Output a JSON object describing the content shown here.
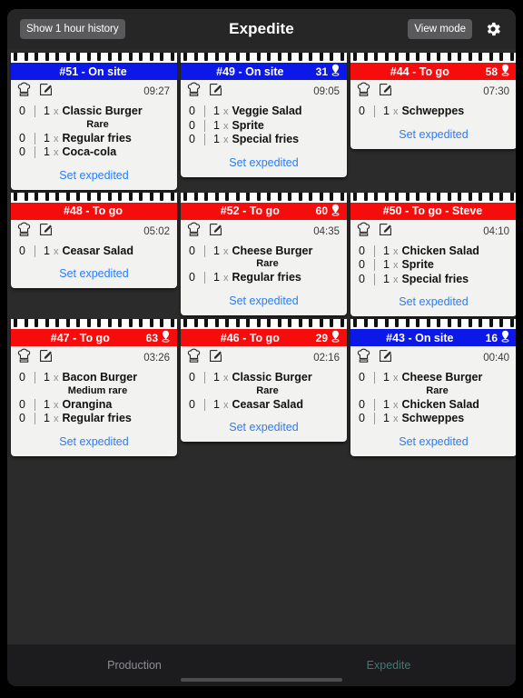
{
  "header": {
    "history_button": "Show 1 hour history",
    "title": "Expedite",
    "view_mode_button": "View mode",
    "gear_icon": "gear-icon"
  },
  "labels": {
    "multiplier": "x",
    "set_expedited": "Set expedited",
    "chef_hat_icon": "chef-hat-icon",
    "edit_icon": "edit-icon",
    "location_pin_icon": "location-pin-icon"
  },
  "tabs": [
    {
      "label": "Production",
      "active": false
    },
    {
      "label": "Expedite",
      "active": true
    }
  ],
  "colors": {
    "on_site": "#0b18e8",
    "to_go": "#f60c0c",
    "accent_link": "#2a7cf7",
    "tab_active": "#3f7a78",
    "board_bg": "#2b2b2b"
  },
  "rows": [
    [
      {
        "id": "#51",
        "title": "#51 - On site",
        "type": "on site",
        "table": "",
        "timer": "09:27",
        "action": "Set expedited",
        "lines": [
          {
            "done": "0",
            "qty": "1",
            "name": "Classic Burger",
            "mod": "Rare"
          },
          {
            "done": "0",
            "qty": "1",
            "name": "Regular fries",
            "mod": ""
          },
          {
            "done": "0",
            "qty": "1",
            "name": "Coca-cola",
            "mod": ""
          }
        ]
      },
      {
        "id": "#49",
        "title": "#49 - On site",
        "type": "on site",
        "table": "31",
        "timer": "09:05",
        "action": "Set expedited",
        "lines": [
          {
            "done": "0",
            "qty": "1",
            "name": "Veggie Salad",
            "mod": ""
          },
          {
            "done": "0",
            "qty": "1",
            "name": "Sprite",
            "mod": ""
          },
          {
            "done": "0",
            "qty": "1",
            "name": "Special fries",
            "mod": ""
          }
        ]
      },
      {
        "id": "#44",
        "title": "#44 - To go",
        "type": "to go",
        "table": "58",
        "timer": "07:30",
        "action": "Set expedited",
        "lines": [
          {
            "done": "0",
            "qty": "1",
            "name": "Schweppes",
            "mod": ""
          }
        ]
      }
    ],
    [
      {
        "id": "#48",
        "title": "#48 - To go",
        "type": "to go",
        "table": "",
        "timer": "05:02",
        "action": "Set expedited",
        "lines": [
          {
            "done": "0",
            "qty": "1",
            "name": "Ceasar Salad",
            "mod": ""
          }
        ]
      },
      {
        "id": "#52",
        "title": "#52 - To go",
        "type": "to go",
        "table": "60",
        "timer": "04:35",
        "action": "Set expedited",
        "lines": [
          {
            "done": "0",
            "qty": "1",
            "name": "Cheese Burger",
            "mod": "Rare"
          },
          {
            "done": "0",
            "qty": "1",
            "name": "Regular fries",
            "mod": ""
          }
        ]
      },
      {
        "id": "#50",
        "title": "#50 - To go - Steve",
        "type": "to go",
        "table": "",
        "timer": "04:10",
        "action": "Set expedited",
        "lines": [
          {
            "done": "0",
            "qty": "1",
            "name": "Chicken Salad",
            "mod": ""
          },
          {
            "done": "0",
            "qty": "1",
            "name": "Sprite",
            "mod": ""
          },
          {
            "done": "0",
            "qty": "1",
            "name": "Special fries",
            "mod": ""
          }
        ]
      }
    ],
    [
      {
        "id": "#47",
        "title": "#47 - To go",
        "type": "to go",
        "table": "63",
        "timer": "03:26",
        "action": "Set expedited",
        "lines": [
          {
            "done": "0",
            "qty": "1",
            "name": "Bacon Burger",
            "mod": "Medium rare"
          },
          {
            "done": "0",
            "qty": "1",
            "name": "Orangina",
            "mod": ""
          },
          {
            "done": "0",
            "qty": "1",
            "name": "Regular fries",
            "mod": ""
          }
        ]
      },
      {
        "id": "#46",
        "title": "#46 - To go",
        "type": "to go",
        "table": "29",
        "timer": "02:16",
        "action": "Set expedited",
        "lines": [
          {
            "done": "0",
            "qty": "1",
            "name": "Classic Burger",
            "mod": "Rare"
          },
          {
            "done": "0",
            "qty": "1",
            "name": "Ceasar Salad",
            "mod": ""
          }
        ]
      },
      {
        "id": "#43",
        "title": "#43 - On site",
        "type": "on site",
        "table": "16",
        "timer": "00:40",
        "action": "Set expedited",
        "lines": [
          {
            "done": "0",
            "qty": "1",
            "name": "Cheese Burger",
            "mod": "Rare"
          },
          {
            "done": "0",
            "qty": "1",
            "name": "Chicken Salad",
            "mod": ""
          },
          {
            "done": "0",
            "qty": "1",
            "name": "Schweppes",
            "mod": ""
          }
        ]
      }
    ]
  ]
}
